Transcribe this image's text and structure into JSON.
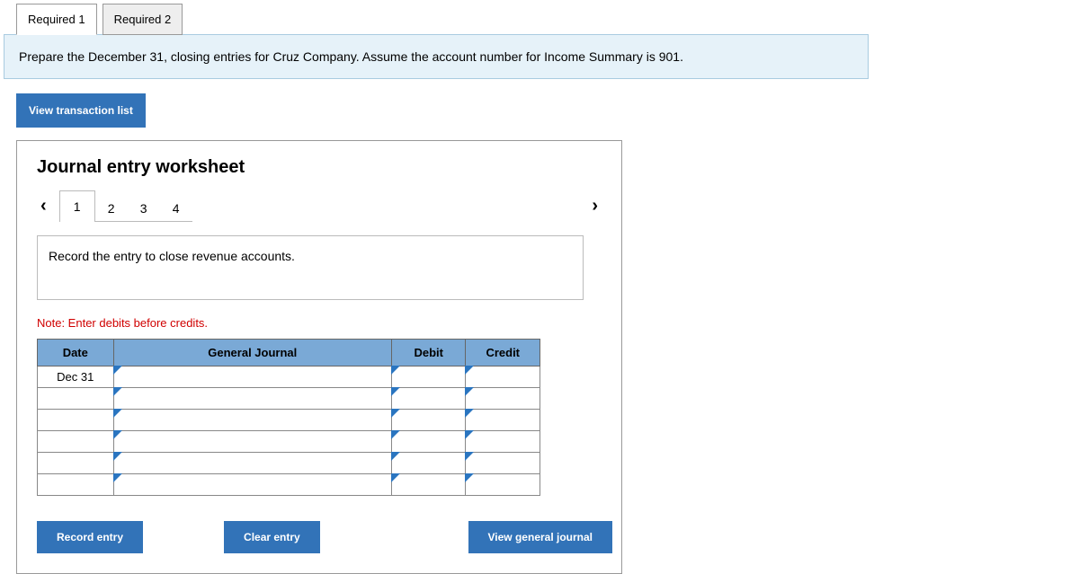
{
  "tabs": {
    "req1": "Required 1",
    "req2": "Required 2"
  },
  "instruction": "Prepare the December 31, closing entries for Cruz Company. Assume the account number for Income Summary is 901.",
  "view_txn_label": "View transaction list",
  "worksheet": {
    "title": "Journal entry worksheet",
    "steps": [
      "1",
      "2",
      "3",
      "4"
    ],
    "step_instruction": "Record the entry to close revenue accounts.",
    "note": "Note: Enter debits before credits.",
    "headers": {
      "date": "Date",
      "gj": "General Journal",
      "debit": "Debit",
      "credit": "Credit"
    },
    "rows": [
      {
        "date": "Dec 31",
        "gj": "",
        "debit": "",
        "credit": ""
      },
      {
        "date": "",
        "gj": "",
        "debit": "",
        "credit": ""
      },
      {
        "date": "",
        "gj": "",
        "debit": "",
        "credit": ""
      },
      {
        "date": "",
        "gj": "",
        "debit": "",
        "credit": ""
      },
      {
        "date": "",
        "gj": "",
        "debit": "",
        "credit": ""
      },
      {
        "date": "",
        "gj": "",
        "debit": "",
        "credit": ""
      }
    ],
    "buttons": {
      "record": "Record entry",
      "clear": "Clear entry",
      "view_gj": "View general journal"
    }
  }
}
